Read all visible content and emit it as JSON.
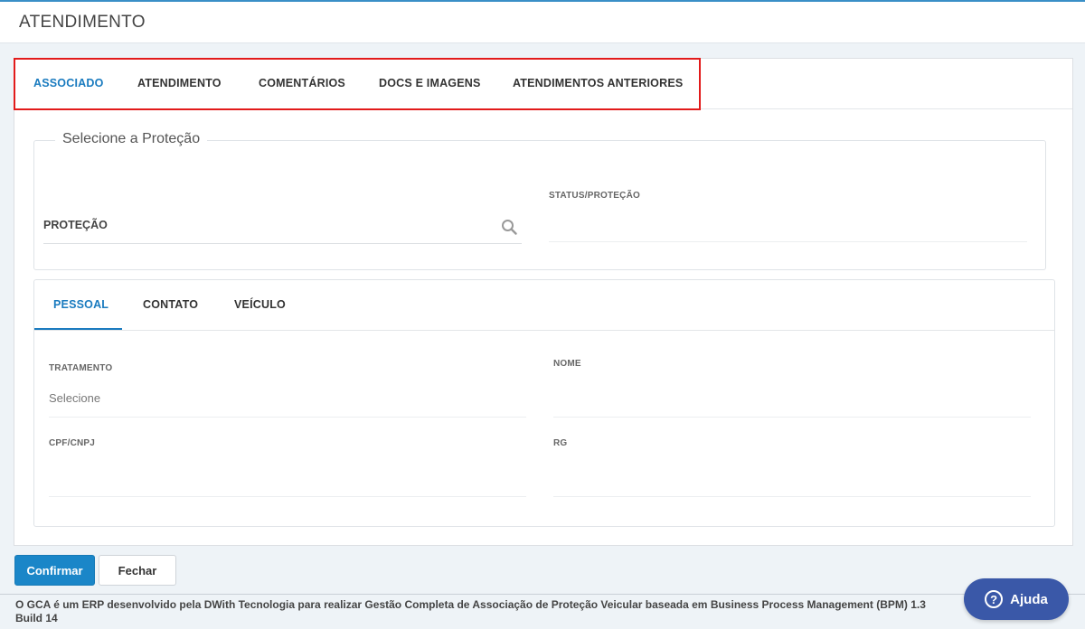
{
  "header": {
    "title": "ATENDIMENTO"
  },
  "tabs": [
    {
      "label": "ASSOCIADO",
      "active": true
    },
    {
      "label": "ATENDIMENTO",
      "active": false
    },
    {
      "label": "COMENTÁRIOS",
      "active": false
    },
    {
      "label": "DOCS E IMAGENS",
      "active": false
    },
    {
      "label": "ATENDIMENTOS ANTERIORES",
      "active": false
    }
  ],
  "protection": {
    "legend": "Selecione a Proteção",
    "protecao_label": "PROTEÇÃO",
    "status_label": "STATUS/PROTEÇÃO",
    "search_icon": "search-icon"
  },
  "subtabs": [
    {
      "label": "PESSOAL",
      "active": true
    },
    {
      "label": "CONTATO",
      "active": false
    },
    {
      "label": "VEÍCULO",
      "active": false
    }
  ],
  "personal": {
    "tratamento_label": "TRATAMENTO",
    "tratamento_value": "Selecione",
    "nome_label": "NOME",
    "cpf_label": "CPF/CNPJ",
    "rg_label": "RG"
  },
  "actions": {
    "confirm": "Confirmar",
    "close": "Fechar"
  },
  "footer": {
    "line1": "O GCA é um ERP desenvolvido pela DWith Tecnologia para realizar Gestão Completa de Associação de Proteção Veicular baseada em Business Process Management (BPM) 1.3",
    "line2": "Build 14"
  },
  "help": {
    "label": "Ajuda",
    "icon": "question-circle-icon"
  },
  "colors": {
    "accent": "#1a7bbf",
    "highlight": "#e21b1b",
    "help_bg": "#3a58a8"
  }
}
